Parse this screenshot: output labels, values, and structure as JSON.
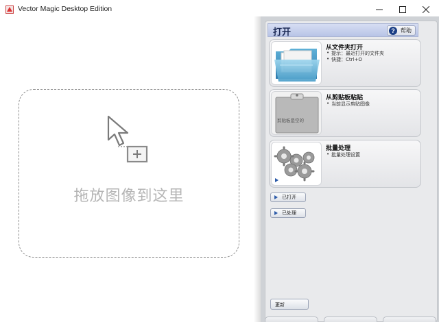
{
  "window": {
    "title": "Vector Magic Desktop Edition",
    "controls": {
      "minimize": "—",
      "maximize": "☐",
      "close": "✕"
    }
  },
  "dropzone": {
    "text": "拖放图像到这里",
    "icon": "cursor-with-plus-icon"
  },
  "panel": {
    "title": "打开",
    "help_label": "帮助",
    "help_icon": "?",
    "actions": [
      {
        "title": "从文件夹打开",
        "lines": [
          "提示：最近打开的文件夹",
          "快捷：Ctrl+O"
        ],
        "icon": "folder-icon"
      },
      {
        "title": "从剪贴板粘贴",
        "lines": [
          "当前显示剪贴图像"
        ],
        "thumb_text": "剪贴板是空的",
        "icon": "clipboard-icon"
      },
      {
        "title": "批量处理",
        "lines": [
          "批量处理设置"
        ],
        "icon": "gears-icon"
      }
    ],
    "recent_label": "已打开",
    "processed_label": "已处理",
    "bottom_button_label": "更新"
  },
  "colors": {
    "panel_bg": "#e9eaec",
    "header_bg": "#c6d0ee",
    "accent": "#2b5aa8",
    "drop_text": "#b5b5b5"
  }
}
